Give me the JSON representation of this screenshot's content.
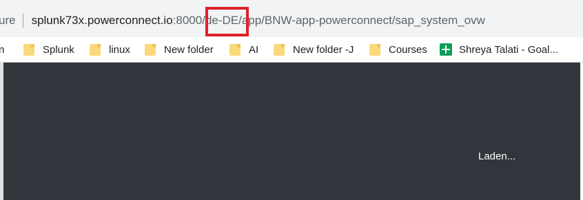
{
  "address_bar": {
    "security_label": "ure",
    "url_host": "splunk73x.powerconnect.io",
    "url_port": ":8000",
    "url_sep1": "/",
    "url_locale": "de-DE",
    "url_path": "/app/BNW-app-powerconnect/sap_system_ovw"
  },
  "bookmarks": [
    {
      "label": "n",
      "icon": "none"
    },
    {
      "label": "Splunk",
      "icon": "folder-icon"
    },
    {
      "label": "linux",
      "icon": "folder-icon"
    },
    {
      "label": "New folder",
      "icon": "folder-icon"
    },
    {
      "label": "AI",
      "icon": "folder-icon"
    },
    {
      "label": "New folder -J",
      "icon": "folder-icon"
    },
    {
      "label": "Courses",
      "icon": "folder-icon"
    },
    {
      "label": "Shreya Talati - Goal...",
      "icon": "sheets-icon"
    }
  ],
  "page": {
    "loading_text": "Laden..."
  },
  "colors": {
    "page_background": "#31363d",
    "highlight": "#e0202a",
    "folder": "#fbd97a",
    "sheets": "#0f9d58"
  }
}
